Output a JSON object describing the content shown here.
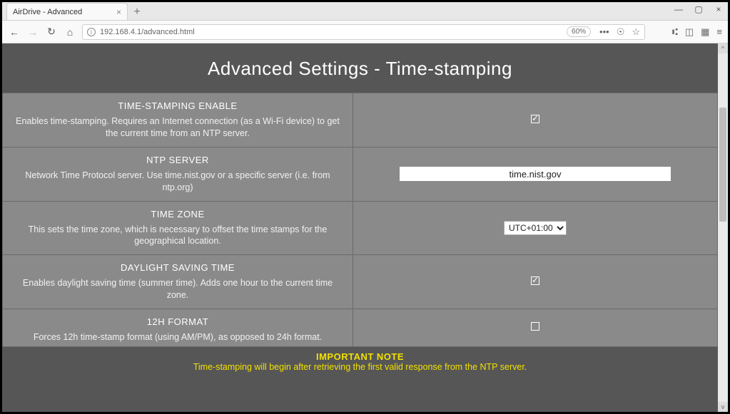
{
  "browser": {
    "tab_title": "AirDrive - Advanced",
    "url": "192.168.4.1/advanced.html",
    "zoom": "60%"
  },
  "page": {
    "heading": "Advanced Settings - Time-stamping"
  },
  "rows": {
    "ts_enable": {
      "title": "TIME-STAMPING ENABLE",
      "desc": "Enables time-stamping. Requires an Internet connection (as a Wi-Fi device) to get the current time from an NTP server.",
      "checked": true
    },
    "ntp": {
      "title": "NTP SERVER",
      "desc": "Network Time Protocol server. Use time.nist.gov or a specific server (i.e. from ntp.org)",
      "value": "time.nist.gov"
    },
    "tz": {
      "title": "TIME ZONE",
      "desc": "This sets the time zone, which is necessary to offset the time stamps for the geographical location.",
      "value": "UTC+01:00"
    },
    "dst": {
      "title": "DAYLIGHT SAVING TIME",
      "desc": "Enables daylight saving time (summer time). Adds one hour to the current time zone.",
      "checked": true
    },
    "fmt12": {
      "title": "12H FORMAT",
      "desc": "Forces 12h time-stamp format (using AM/PM), as opposed to 24h format.",
      "checked": false
    }
  },
  "note": {
    "title": "IMPORTANT NOTE",
    "text": "Time-stamping will begin after retrieving the first valid response from the NTP server."
  }
}
